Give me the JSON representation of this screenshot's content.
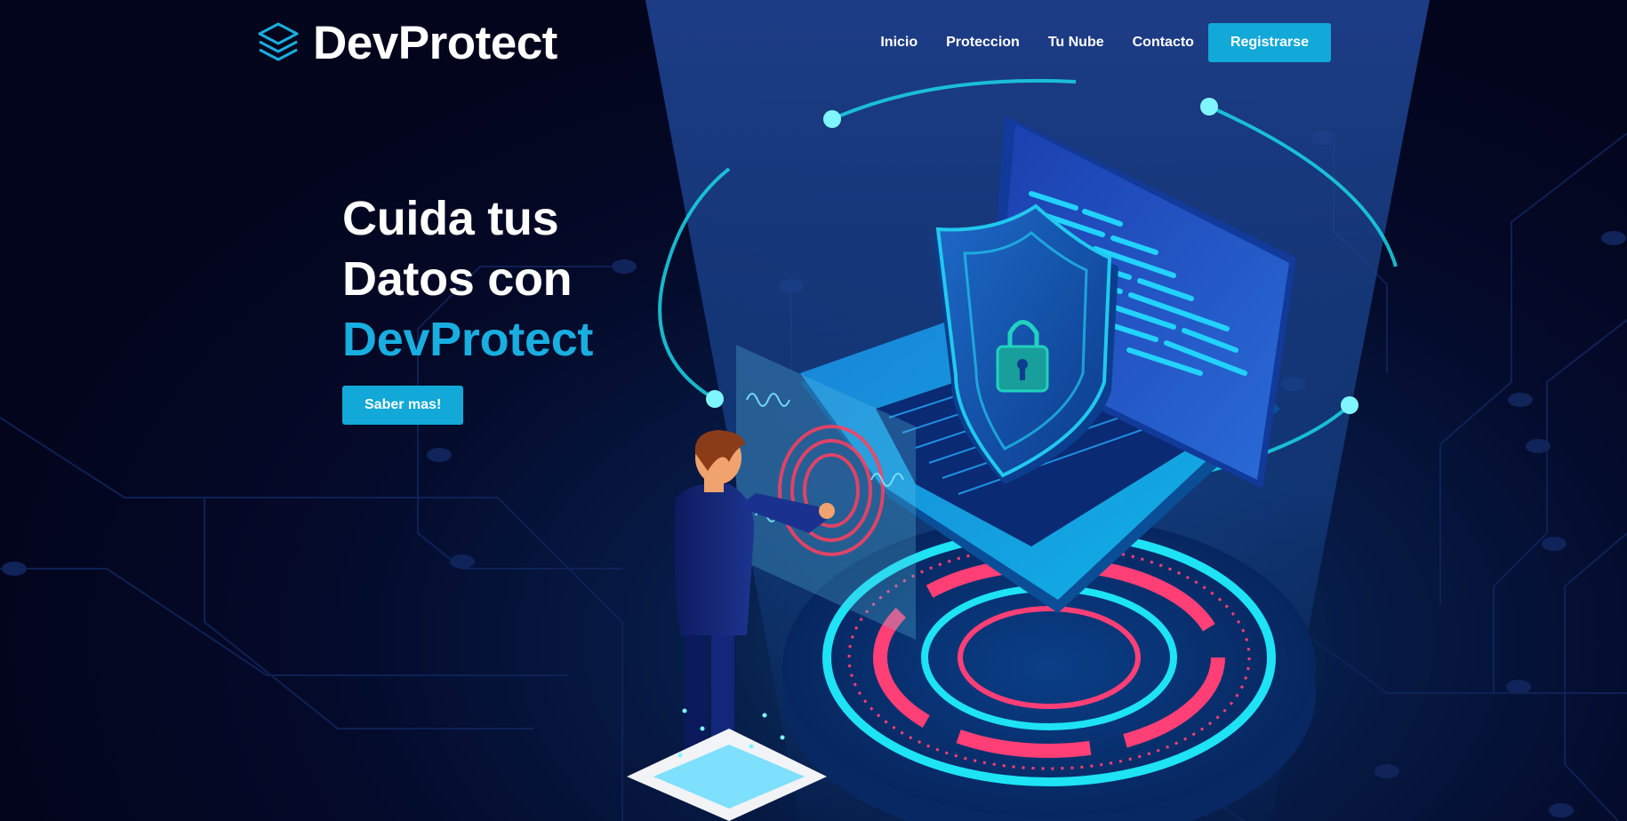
{
  "brand": {
    "name": "DevProtect",
    "icon": "layers-icon",
    "accent_color": "#12a9d8"
  },
  "nav": {
    "items": [
      {
        "label": "Inicio"
      },
      {
        "label": "Proteccion"
      },
      {
        "label": "Tu Nube"
      },
      {
        "label": "Contacto"
      }
    ],
    "cta_label": "Registrarse"
  },
  "hero": {
    "title_line1": "Cuida tus",
    "title_line2": "Datos con",
    "title_accent": "DevProtect",
    "button_label": "Saber mas!"
  },
  "colors": {
    "background": "#03051c",
    "accent": "#19aee0",
    "text": "#ffffff"
  }
}
